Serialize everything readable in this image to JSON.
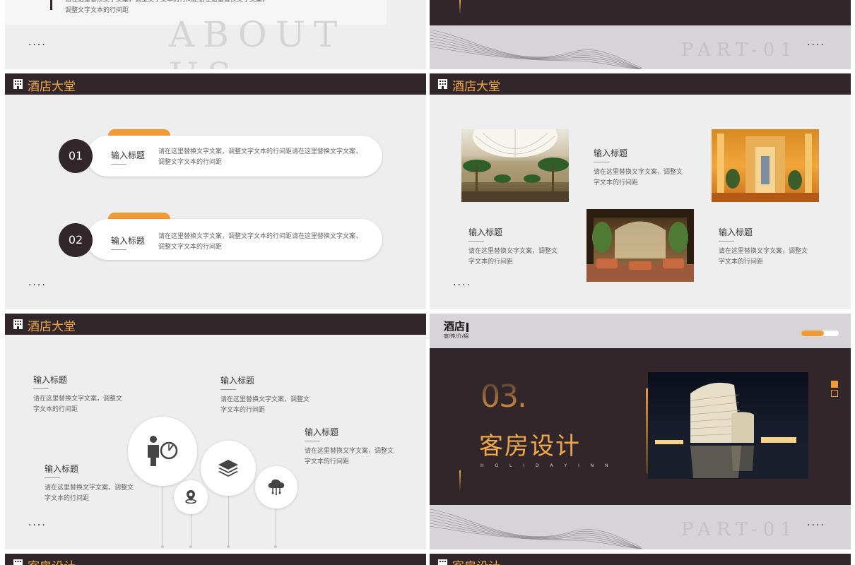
{
  "slide_about": {
    "body_line1": "请在这里替换文字文案，调整文字文本的行间距请在这里替换文字文案，",
    "body_line2": "调整文字文本的行间距",
    "ghost_text": "ABOUT US",
    "dots": "····"
  },
  "slide_part_top": {
    "ghost_text": "PART-01",
    "dots": "····"
  },
  "slide_lobby_list": {
    "header": "酒店大堂",
    "items": [
      {
        "number": "01",
        "title": "输入标题",
        "body": "请在这里替换文字文案，调整文字文本的行间距请在这里替换文字文案，调整文字文本的行间距"
      },
      {
        "number": "02",
        "title": "输入标题",
        "body": "请在这里替换文字文案，调整文字文本的行间距请在这里替换文字文案，调整文字文本的行间距"
      }
    ],
    "dots": "····"
  },
  "slide_lobby_gallery": {
    "header": "酒店大堂",
    "items": [
      {
        "title": "输入标题",
        "body": "请在这里替换文字文案，调整文字文本的行间距"
      },
      {
        "title": "输入标题",
        "body": "请在这里替换文字文案，调整文字文本的行间距"
      },
      {
        "title": "输入标题",
        "body": "请在这里替换文字文案，调整文字文本的行间距"
      }
    ],
    "dots": "····"
  },
  "slide_lobby_bubbles": {
    "header": "酒店大堂",
    "items": [
      {
        "title": "输入标题",
        "body": "请在这里替换文字文案，调整文字文本的行间距"
      },
      {
        "title": "输入标题",
        "body": "请在这里替换文字文案，调整文字文本的行间距"
      },
      {
        "title": "输入标题",
        "body": "请在这里替换文字文案，调整文字文本的行间距"
      },
      {
        "title": "输入标题",
        "body": "请在这里替换文字文案，调整文字文本的行间距"
      }
    ],
    "icons": [
      "businessman-clock-icon",
      "location-pin-icon",
      "layers-icon",
      "cloud-network-icon"
    ],
    "dots": "····"
  },
  "slide_rooms_cover": {
    "logo_main": "酒店",
    "logo_sub": "宣/传/介/绍",
    "number": "03.",
    "title": "客房设计",
    "subtitle": "H O L I D A Y   I N N",
    "ghost_text": "PART-01",
    "dots": "····",
    "progress": 0.6
  },
  "slide_bottom_left": {
    "header": "客房设计"
  },
  "slide_bottom_right": {
    "header": "客房设计"
  },
  "colors": {
    "accent": "#f09a38",
    "dark": "#31262a",
    "background": "#efeeef"
  }
}
